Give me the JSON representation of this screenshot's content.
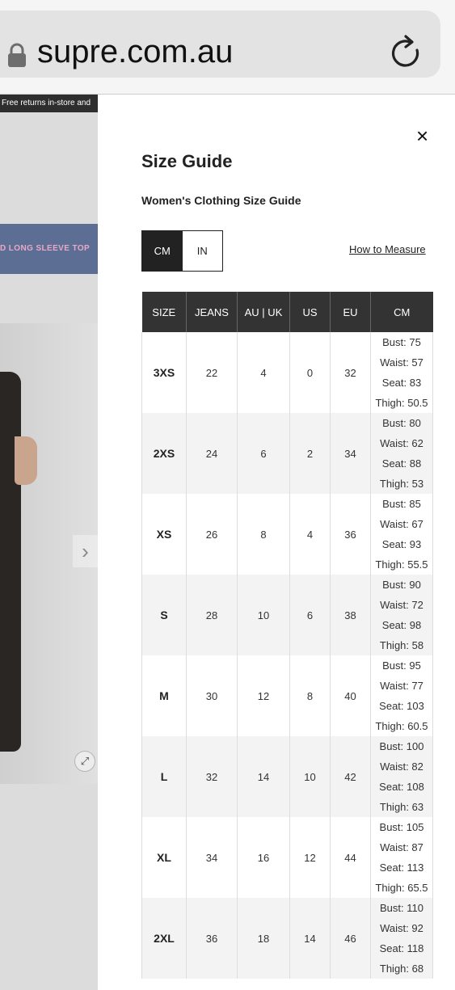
{
  "browser": {
    "url": "supre.com.au"
  },
  "background": {
    "promo_text": "Free returns in-store and",
    "banner_text": "D LONG SLEEVE TOP",
    "next_arrow": "›",
    "expand": "⤢"
  },
  "modal": {
    "close": "×",
    "title": "Size Guide",
    "subtitle": "Women's Clothing Size Guide",
    "units": [
      "CM",
      "IN"
    ],
    "selected_unit": "CM",
    "measure_link": "How to Measure",
    "table": {
      "headers": [
        "SIZE",
        "JEANS",
        "AU | UK",
        "US",
        "EU",
        "CM"
      ],
      "rows": [
        {
          "size": "3XS",
          "jeans": "22",
          "au_uk": "4",
          "us": "0",
          "eu": "32",
          "cm": [
            "Bust: 75",
            "Waist: 57",
            "Seat: 83",
            "Thigh: 50.5"
          ]
        },
        {
          "size": "2XS",
          "jeans": "24",
          "au_uk": "6",
          "us": "2",
          "eu": "34",
          "cm": [
            "Bust: 80",
            "Waist: 62",
            "Seat: 88",
            "Thigh: 53"
          ]
        },
        {
          "size": "XS",
          "jeans": "26",
          "au_uk": "8",
          "us": "4",
          "eu": "36",
          "cm": [
            "Bust: 85",
            "Waist: 67",
            "Seat: 93",
            "Thigh: 55.5"
          ]
        },
        {
          "size": "S",
          "jeans": "28",
          "au_uk": "10",
          "us": "6",
          "eu": "38",
          "cm": [
            "Bust: 90",
            "Waist: 72",
            "Seat: 98",
            "Thigh: 58"
          ]
        },
        {
          "size": "M",
          "jeans": "30",
          "au_uk": "12",
          "us": "8",
          "eu": "40",
          "cm": [
            "Bust: 95",
            "Waist: 77",
            "Seat: 103",
            "Thigh: 60.5"
          ]
        },
        {
          "size": "L",
          "jeans": "32",
          "au_uk": "14",
          "us": "10",
          "eu": "42",
          "cm": [
            "Bust: 100",
            "Waist: 82",
            "Seat: 108",
            "Thigh: 63"
          ]
        },
        {
          "size": "XL",
          "jeans": "34",
          "au_uk": "16",
          "us": "12",
          "eu": "44",
          "cm": [
            "Bust: 105",
            "Waist: 87",
            "Seat: 113",
            "Thigh: 65.5"
          ]
        },
        {
          "size": "2XL",
          "jeans": "36",
          "au_uk": "18",
          "us": "14",
          "eu": "46",
          "cm": [
            "Bust: 110",
            "Waist: 92",
            "Seat: 118",
            "Thigh: 68"
          ]
        }
      ]
    }
  }
}
